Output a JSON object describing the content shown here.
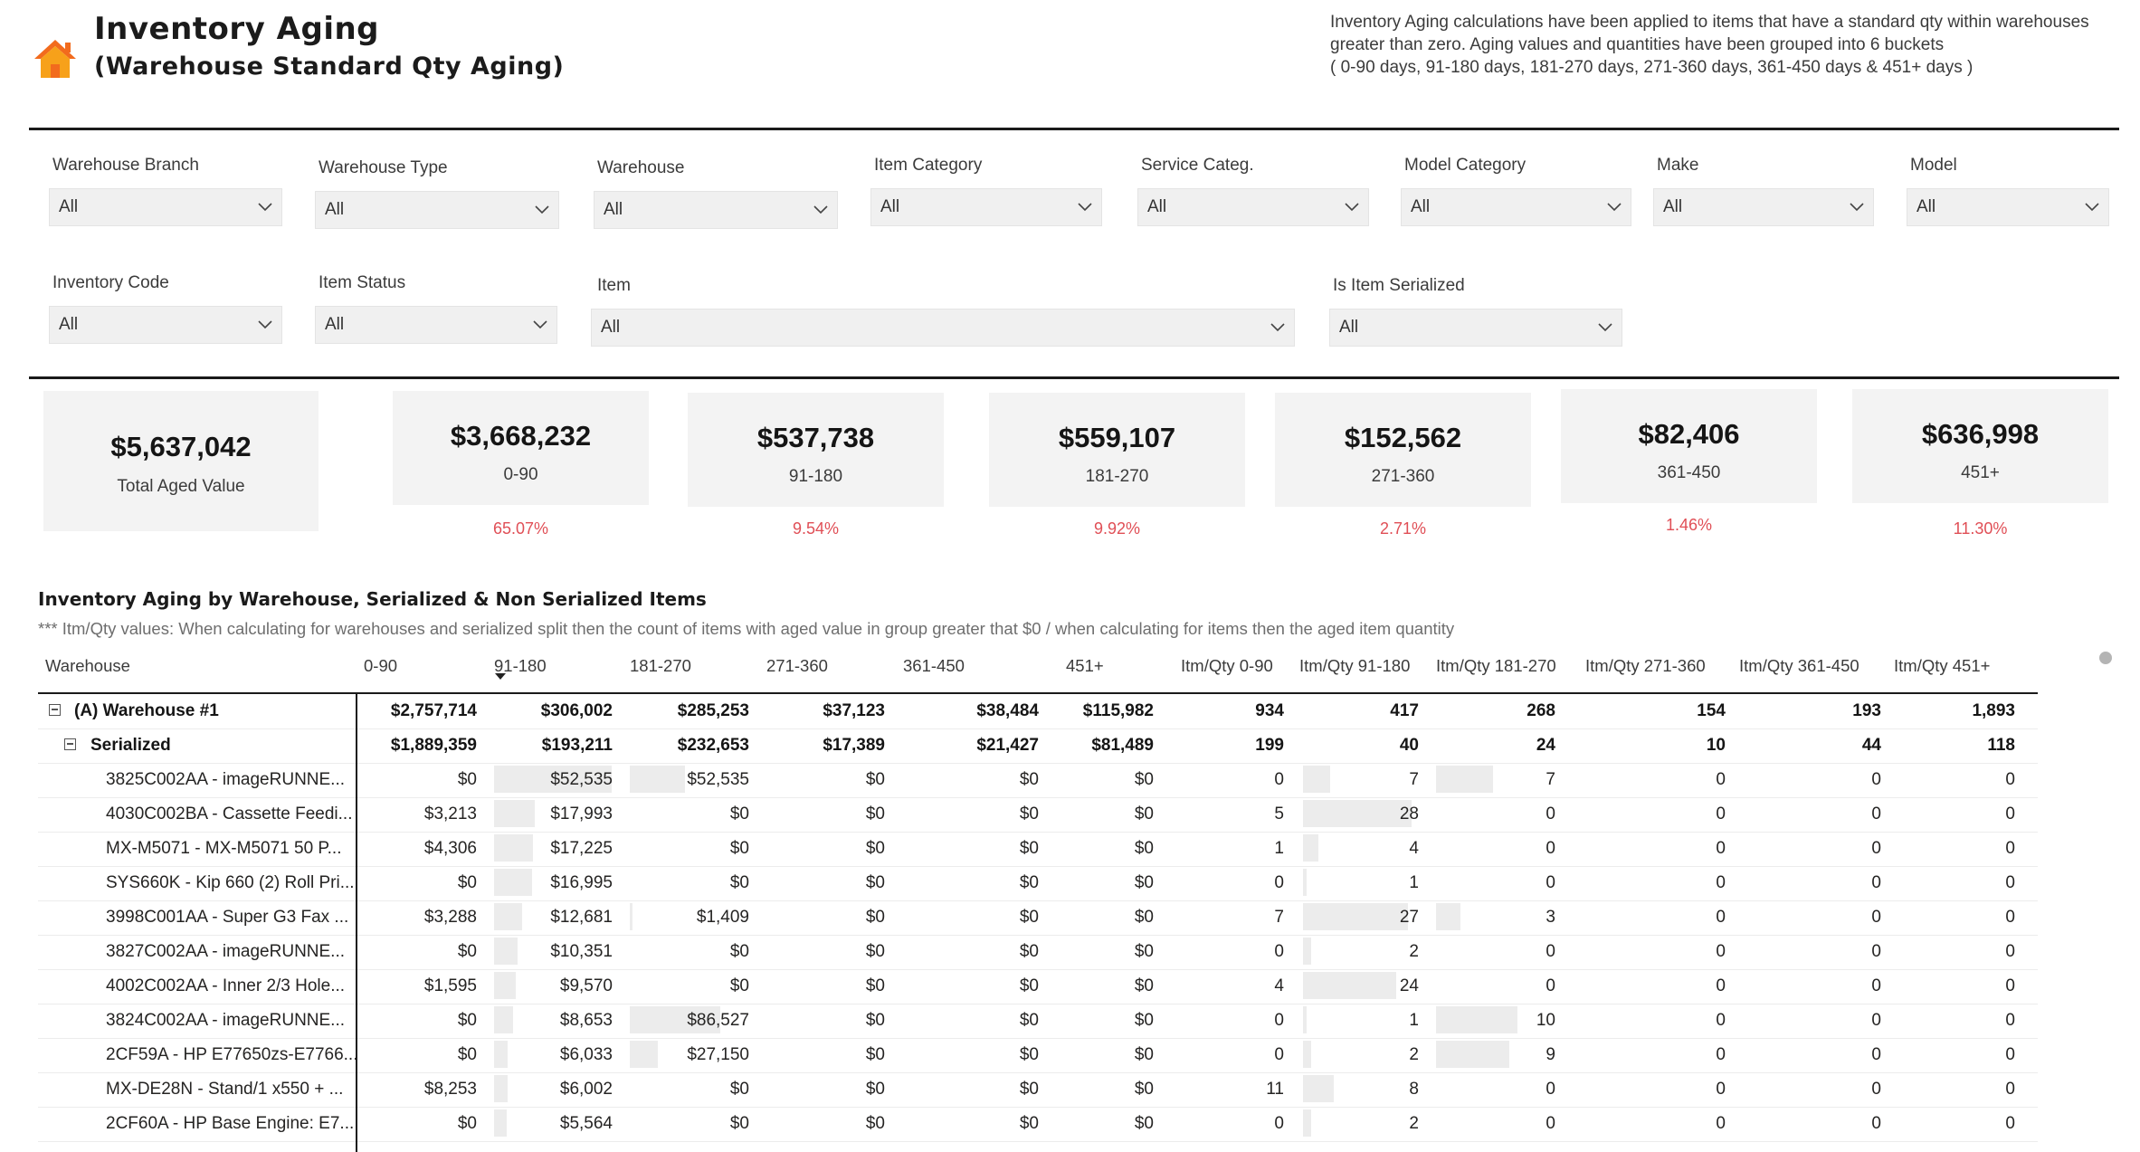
{
  "header": {
    "title_line1": "Inventory Aging",
    "title_line2": "(Warehouse Standard Qty Aging)",
    "description_lines": [
      "Inventory Aging calculations have been applied to items that have a standard qty within warehouses",
      "greater than zero. Aging values and quantities have been grouped into 6 buckets",
      "( 0-90 days, 91-180 days, 181-270 days, 271-360 days, 361-450 days & 451+ days )"
    ],
    "home_icon": "home-icon",
    "accent_color": "#f47a20"
  },
  "filters": {
    "row1": [
      {
        "label": "Warehouse Branch",
        "value": "All"
      },
      {
        "label": "Warehouse Type",
        "value": "All"
      },
      {
        "label": "Warehouse",
        "value": "All"
      },
      {
        "label": "Item Category",
        "value": "All"
      },
      {
        "label": "Service Categ.",
        "value": "All"
      },
      {
        "label": "Model Category",
        "value": "All"
      },
      {
        "label": "Make",
        "value": "All"
      },
      {
        "label": "Model",
        "value": "All"
      }
    ],
    "row2": [
      {
        "label": "Inventory Code",
        "value": "All"
      },
      {
        "label": "Item Status",
        "value": "All"
      },
      {
        "label": "Item",
        "value": "All"
      },
      {
        "label": "Is Item Serialized",
        "value": "All"
      }
    ]
  },
  "cards": [
    {
      "value": "$5,637,042",
      "label": "Total Aged Value",
      "pct": ""
    },
    {
      "value": "$3,668,232",
      "label": "0-90",
      "pct": "65.07%"
    },
    {
      "value": "$537,738",
      "label": "91-180",
      "pct": "9.54%"
    },
    {
      "value": "$559,107",
      "label": "181-270",
      "pct": "9.92%"
    },
    {
      "value": "$152,562",
      "label": "271-360",
      "pct": "2.71%"
    },
    {
      "value": "$82,406",
      "label": "361-450",
      "pct": "1.46%"
    },
    {
      "value": "$636,998",
      "label": "451+",
      "pct": "11.30%"
    }
  ],
  "pct_color": "#e04f56",
  "table": {
    "title": "Inventory Aging by Warehouse, Serialized & Non Serialized Items",
    "note": "*** Itm/Qty values: When calculating for warehouses and serialized split then the count of items with aged value in group greater that $0 / when calculating for items then the aged item quantity",
    "columns": [
      "Warehouse",
      "0-90",
      "91-180",
      "181-270",
      "271-360",
      "361-450",
      "451+",
      "Itm/Qty 0-90",
      "Itm/Qty 91-180",
      "Itm/Qty 181-270",
      "Itm/Qty 271-360",
      "Itm/Qty 361-450",
      "Itm/Qty 451+"
    ],
    "sorted_column": "91-180",
    "rows": [
      {
        "level": 0,
        "name": "(A) Warehouse #1",
        "values": [
          "$2,757,714",
          "$306,002",
          "$285,253",
          "$37,123",
          "$38,484",
          "$115,982",
          "934",
          "417",
          "268",
          "154",
          "193",
          "1,893"
        ]
      },
      {
        "level": 1,
        "name": "Serialized",
        "values": [
          "$1,889,359",
          "$193,211",
          "$232,653",
          "$17,389",
          "$21,427",
          "$81,489",
          "199",
          "40",
          "24",
          "10",
          "44",
          "118"
        ]
      },
      {
        "level": 2,
        "name": "3825C002AA - imageRUNNE...",
        "values": [
          "$0",
          "$52,535",
          "$52,535",
          "$0",
          "$0",
          "$0",
          "0",
          "7",
          "7",
          "0",
          "0",
          "0"
        ]
      },
      {
        "level": 2,
        "name": "4030C002BA - Cassette Feedi...",
        "values": [
          "$3,213",
          "$17,993",
          "$0",
          "$0",
          "$0",
          "$0",
          "5",
          "28",
          "0",
          "0",
          "0",
          "0"
        ]
      },
      {
        "level": 2,
        "name": "MX-M5071 - MX-M5071 50 P...",
        "values": [
          "$4,306",
          "$17,225",
          "$0",
          "$0",
          "$0",
          "$0",
          "1",
          "4",
          "0",
          "0",
          "0",
          "0"
        ]
      },
      {
        "level": 2,
        "name": "SYS660K - Kip 660 (2) Roll Pri...",
        "values": [
          "$0",
          "$16,995",
          "$0",
          "$0",
          "$0",
          "$0",
          "0",
          "1",
          "0",
          "0",
          "0",
          "0"
        ]
      },
      {
        "level": 2,
        "name": "3998C001AA - Super G3 Fax ...",
        "values": [
          "$3,288",
          "$12,681",
          "$1,409",
          "$0",
          "$0",
          "$0",
          "7",
          "27",
          "3",
          "0",
          "0",
          "0"
        ]
      },
      {
        "level": 2,
        "name": "3827C002AA - imageRUNNE...",
        "values": [
          "$0",
          "$10,351",
          "$0",
          "$0",
          "$0",
          "$0",
          "0",
          "2",
          "0",
          "0",
          "0",
          "0"
        ]
      },
      {
        "level": 2,
        "name": "4002C002AA - Inner 2/3 Hole...",
        "values": [
          "$1,595",
          "$9,570",
          "$0",
          "$0",
          "$0",
          "$0",
          "4",
          "24",
          "0",
          "0",
          "0",
          "0"
        ]
      },
      {
        "level": 2,
        "name": "3824C002AA - imageRUNNE...",
        "values": [
          "$0",
          "$8,653",
          "$86,527",
          "$0",
          "$0",
          "$0",
          "0",
          "1",
          "10",
          "0",
          "0",
          "0"
        ]
      },
      {
        "level": 2,
        "name": "2CF59A - HP E77650zs-E7766...",
        "values": [
          "$0",
          "$6,033",
          "$27,150",
          "$0",
          "$0",
          "$0",
          "0",
          "2",
          "9",
          "0",
          "0",
          "0"
        ]
      },
      {
        "level": 2,
        "name": "MX-DE28N - Stand/1 x550 + ...",
        "values": [
          "$8,253",
          "$6,002",
          "$0",
          "$0",
          "$0",
          "$0",
          "11",
          "8",
          "0",
          "0",
          "0",
          "0"
        ]
      },
      {
        "level": 2,
        "name": "2CF60A - HP Base Engine: E7...",
        "values": [
          "$0",
          "$5,564",
          "$0",
          "$0",
          "$0",
          "$0",
          "0",
          "2",
          "0",
          "0",
          "0",
          "0"
        ]
      }
    ]
  }
}
